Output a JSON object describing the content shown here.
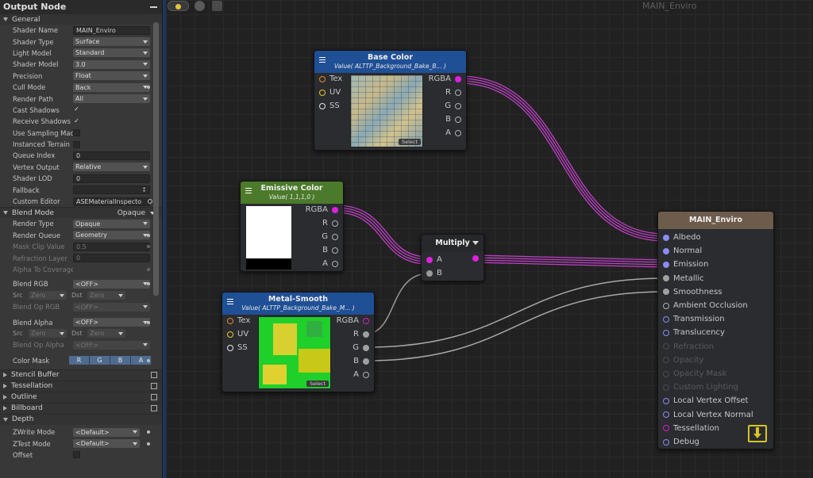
{
  "panel": {
    "title": "Output Node",
    "general": "General",
    "shader_name": {
      "label": "Shader Name",
      "value": "MAIN_Enviro"
    },
    "shader_type": {
      "label": "Shader Type",
      "value": "Surface"
    },
    "light_model": {
      "label": "Light Model",
      "value": "Standard"
    },
    "shader_model": {
      "label": "Shader Model",
      "value": "3.0"
    },
    "precision": {
      "label": "Precision",
      "value": "Float"
    },
    "cull_mode": {
      "label": "Cull Mode",
      "value": "Back"
    },
    "render_path": {
      "label": "Render Path",
      "value": "All"
    },
    "cast_shadows": {
      "label": "Cast Shadows",
      "check": "✓"
    },
    "receive_shadows": {
      "label": "Receive Shadows",
      "check": "✓"
    },
    "use_sampling": {
      "label": "Use Sampling Mac"
    },
    "instanced_terrain": {
      "label": "Instanced Terrain"
    },
    "queue_index": {
      "label": "Queue Index",
      "value": "0"
    },
    "vertex_output": {
      "label": "Vertex Output",
      "value": "Relative"
    },
    "shader_lod": {
      "label": "Shader LOD",
      "value": "0"
    },
    "fallback": {
      "label": "Fallback",
      "value": ""
    },
    "custom_editor": {
      "label": "Custom Editor",
      "value": "ASEMaterialInspecto"
    },
    "blend_mode": {
      "label": "Blend Mode",
      "value": "Opaque"
    },
    "render_type": {
      "label": "Render Type",
      "value": "Opaque"
    },
    "render_queue": {
      "label": "Render Queue",
      "value": "Geometry"
    },
    "mask_clip": {
      "label": "Mask Clip Value",
      "value": "0.5"
    },
    "refraction_layer": {
      "label": "Refraction Layer",
      "value": "0"
    },
    "alpha_to_coverage": {
      "label": "Alpha To Coverage"
    },
    "blend_rgb": {
      "label": "Blend RGB",
      "value": "<OFF>"
    },
    "src_rgb": {
      "src": "Src",
      "src_val": "Zero",
      "dst": "Dst",
      "dst_val": "Zero"
    },
    "blend_op_rgb": {
      "label": "Blend Op RGB",
      "value": "<OFF>"
    },
    "blend_alpha": {
      "label": "Blend Alpha",
      "value": "<OFF>"
    },
    "src_alpha": {
      "src": "Src",
      "src_val": "Zero",
      "dst": "Dst",
      "dst_val": "Zero"
    },
    "blend_op_alpha": {
      "label": "Blend Op Alpha",
      "value": "<OFF>"
    },
    "color_mask": {
      "label": "Color Mask",
      "r": "R",
      "g": "G",
      "b": "B",
      "a": "A"
    },
    "stencil": "Stencil Buffer",
    "tessellation": "Tessellation",
    "outline": "Outline",
    "billboard": "Billboard",
    "depth": "Depth",
    "zwrite": {
      "label": "ZWrite Mode",
      "value": "<Default>"
    },
    "ztest": {
      "label": "ZTest Mode",
      "value": "<Default>"
    },
    "offset": {
      "label": "Offset"
    }
  },
  "canvas": {
    "title": "MAIN_Enviro"
  },
  "nodes": {
    "base_color": {
      "title": "Base Color",
      "sub": "Value( ALTTP_Background_Bake_B... )",
      "tex": "Tex",
      "uv": "UV",
      "ss": "SS",
      "rgba": "RGBA",
      "r": "R",
      "g": "G",
      "b": "B",
      "a": "A",
      "select": "Select"
    },
    "emissive": {
      "title": "Emissive Color",
      "sub": "Value( 1,1,1,0 )",
      "rgba": "RGBA",
      "r": "R",
      "g": "G",
      "b": "B",
      "a": "A"
    },
    "multiply": {
      "title": "Multiply",
      "a": "A",
      "b": "B"
    },
    "metal": {
      "title": "Metal-Smooth",
      "sub": "Value( ALTTP_Background_Bake_M... )",
      "tex": "Tex",
      "uv": "UV",
      "ss": "SS",
      "rgba": "RGBA",
      "r": "R",
      "g": "G",
      "b": "B",
      "a": "A",
      "select": "Select"
    },
    "main": {
      "title": "MAIN_Enviro",
      "inputs": [
        "Albedo",
        "Normal",
        "Emission",
        "Metallic",
        "Smoothness",
        "Ambient Occlusion",
        "Transmission",
        "Translucency",
        "Refraction",
        "Opacity",
        "Opacity Mask",
        "Custom Lighting",
        "Local Vertex Offset",
        "Local Vertex Normal",
        "Tessellation",
        "Debug"
      ]
    }
  },
  "colors": {
    "wire_magenta": "#c040c8",
    "wire_gray": "#9a9a9a",
    "accent_blue": "#1f4f95"
  }
}
